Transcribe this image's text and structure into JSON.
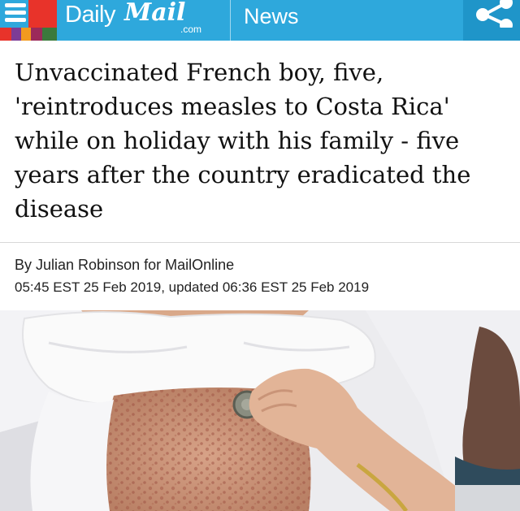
{
  "header": {
    "logo_daily": "Daily",
    "logo_mail": "Mail",
    "logo_com": ".com",
    "section": "News",
    "menu_icon": "hamburger-menu-icon",
    "share_icon": "share-icon",
    "colors": {
      "bar": "#2ea8dc",
      "share_bg": "#1f95c9"
    }
  },
  "article": {
    "headline": "Unvaccinated French boy, five, 'reintroduces measles to Costa Rica' while on holiday with his family - five years after the country eradicated the disease",
    "byline": "By Julian Robinson for MailOnline",
    "dateline": "05:45 EST 25 Feb 2019, updated 06:36 EST 25 Feb 2019"
  },
  "image": {
    "description_icon": "child-stethoscope-photo"
  }
}
